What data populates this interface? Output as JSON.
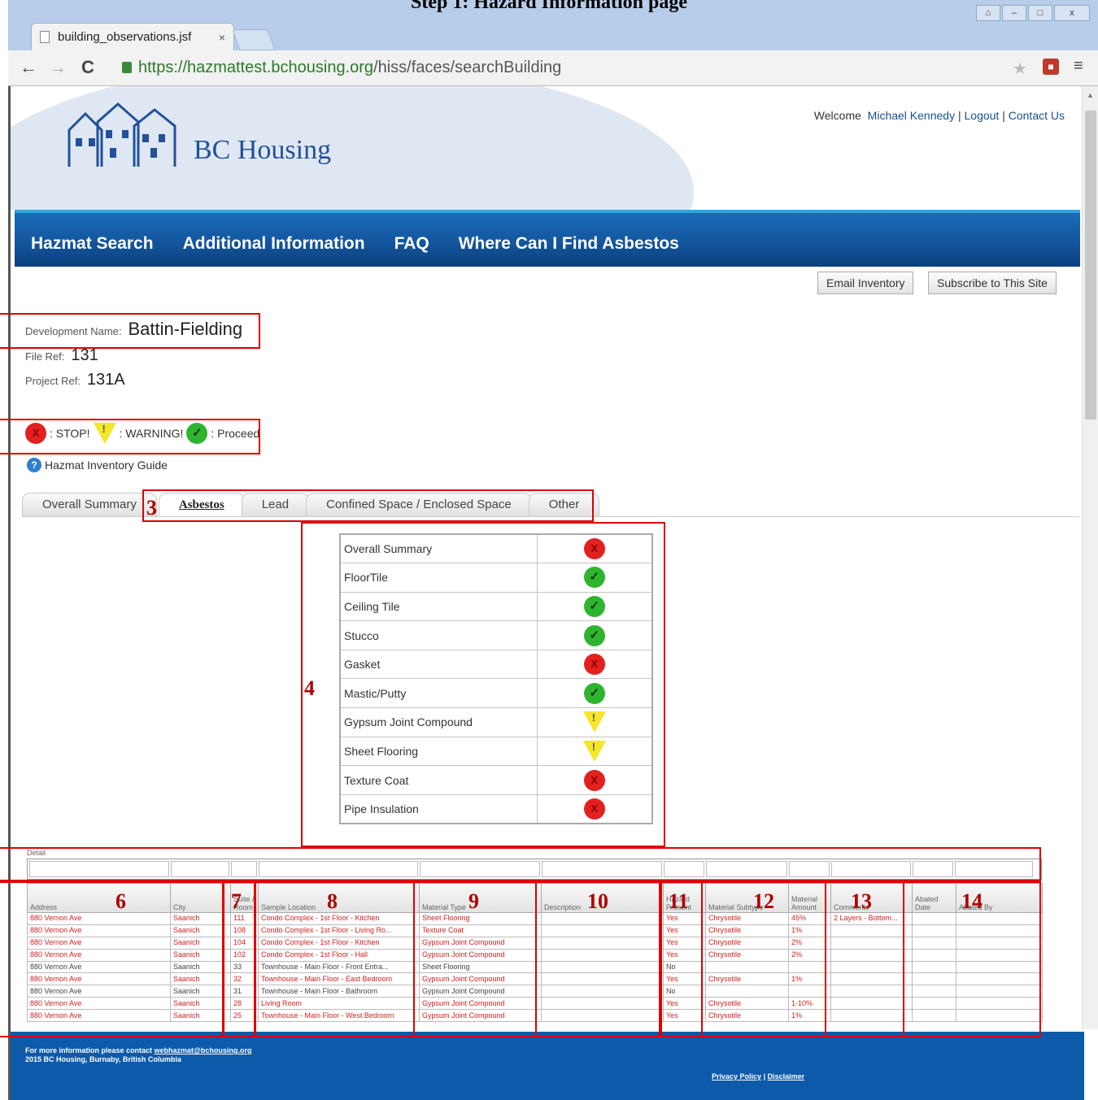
{
  "document": {
    "heading": "Step 1: Hazard Information page"
  },
  "browser": {
    "tab_title": "building_observations.jsf",
    "tab_close": "×",
    "url_host": "https://hazmattest.bchousing.org",
    "url_path": "/hiss/faces/searchBuilding",
    "window_buttons": [
      "⌂",
      "–",
      "□",
      "x"
    ]
  },
  "header": {
    "brand": "BC Housing",
    "welcome": "Welcome",
    "user_name": "Michael Kennedy",
    "sep": "|",
    "logout": "Logout",
    "contact": "Contact Us"
  },
  "nav": {
    "items": [
      "Hazmat Search",
      "Additional Information",
      "FAQ",
      "Where Can I Find Asbestos"
    ]
  },
  "actions": {
    "email_inventory": "Email Inventory",
    "subscribe": "Subscribe to This Site"
  },
  "development": {
    "name_label": "Development Name:",
    "name_value": "Battin-Fielding",
    "file_ref_label": "File Ref:",
    "file_ref_value": "131",
    "project_ref_label": "Project Ref:",
    "project_ref_value": "131A"
  },
  "legend": {
    "stop": ": STOP!",
    "warning": ": WARNING!",
    "proceed": ": Proceed"
  },
  "guide": {
    "label": "Hazmat Inventory Guide"
  },
  "tabs": [
    "Overall Summary",
    "Asbestos",
    "Lead",
    "Confined Space / Enclosed Space",
    "Other"
  ],
  "summary": [
    {
      "label": "Overall Summary",
      "status": "stop"
    },
    {
      "label": "FloorTile",
      "status": "proceed"
    },
    {
      "label": "Ceiling Tile",
      "status": "proceed"
    },
    {
      "label": "Stucco",
      "status": "proceed"
    },
    {
      "label": "Gasket",
      "status": "stop"
    },
    {
      "label": "Mastic/Putty",
      "status": "proceed"
    },
    {
      "label": "Gypsum Joint Compound",
      "status": "warning"
    },
    {
      "label": "Sheet Flooring",
      "status": "warning"
    },
    {
      "label": "Texture Coat",
      "status": "stop"
    },
    {
      "label": "Pipe Insulation",
      "status": "stop"
    }
  ],
  "detail": {
    "label": "Detail",
    "columns": [
      "Address",
      "City",
      "Suite / Room",
      "Sample Location",
      "Material Type",
      "Description",
      "Hazard Present",
      "Material Subtype",
      "Material Amount",
      "Comments",
      "Abated Date",
      "Abated By"
    ],
    "rows": [
      [
        "880 Vernon Ave",
        "Saanich",
        "111",
        "Condo Complex - 1st Floor - Kitchen",
        "Sheet Flooring",
        "",
        "Yes",
        "Chrysotile",
        "45%",
        "2 Layers - Bottom...",
        "",
        ""
      ],
      [
        "880 Vernon Ave",
        "Saanich",
        "108",
        "Condo Complex - 1st Floor - Living Ro...",
        "Texture Coat",
        "",
        "Yes",
        "Chrysotile",
        "1%",
        "",
        "",
        ""
      ],
      [
        "880 Vernon Ave",
        "Saanich",
        "104",
        "Condo Complex - 1st Floor - Kitchen",
        "Gypsum Joint Compound",
        "",
        "Yes",
        "Chrysotile",
        "2%",
        "",
        "",
        ""
      ],
      [
        "880 Vernon Ave",
        "Saanich",
        "102",
        "Condo Complex - 1st Floor - Hall",
        "Gypsum Joint Compound",
        "",
        "Yes",
        "Chrysotile",
        "2%",
        "",
        "",
        ""
      ],
      [
        "880 Vernon Ave",
        "Saanich",
        "33",
        "Townhouse - Main Floor - Front Entra...",
        "Sheet Flooring",
        "",
        "No",
        "",
        "",
        "",
        "",
        ""
      ],
      [
        "880 Vernon Ave",
        "Saanich",
        "32",
        "Townhouse - Main Floor - East Bedroom",
        "Gypsum Joint Compound",
        "",
        "Yes",
        "Chrysotile",
        "1%",
        "",
        "",
        ""
      ],
      [
        "880 Vernon Ave",
        "Saanich",
        "31",
        "Townhouse - Main Floor - Bathroom",
        "Gypsum Joint Compound",
        "",
        "No",
        "",
        "",
        "",
        "",
        ""
      ],
      [
        "880 Vernon Ave",
        "Saanich",
        "28",
        "Living Room",
        "Gypsum Joint Compound",
        "",
        "Yes",
        "Chrysotile",
        "1-10%",
        "",
        "",
        ""
      ],
      [
        "880 Vernon Ave",
        "Saanich",
        "25",
        "Townhouse - Main Floor - West Bedroom",
        "Gypsum Joint Compound",
        "",
        "Yes",
        "Chrysotile",
        "1%",
        "",
        "",
        ""
      ]
    ]
  },
  "footer": {
    "info_prefix": "For more information please contact",
    "email": "webhazmat@bchousing.org",
    "copyright": "2015 BC Housing, Burnaby, British Columbia",
    "privacy": "Privacy Policy",
    "sep": "|",
    "disclaimer": "Disclaimer"
  },
  "annotations": {
    "numbers": [
      "3",
      "4",
      "6",
      "7",
      "8",
      "9",
      "10",
      "11",
      "12",
      "13",
      "14"
    ]
  },
  "colors": {
    "nav_blue": "#1458a0",
    "footer_blue": "#0d5aab",
    "hazard_red": "#d42020",
    "annotation_red": "#e00000",
    "stop": "#e32020",
    "warning": "#f5e629",
    "proceed": "#2fb42f"
  }
}
